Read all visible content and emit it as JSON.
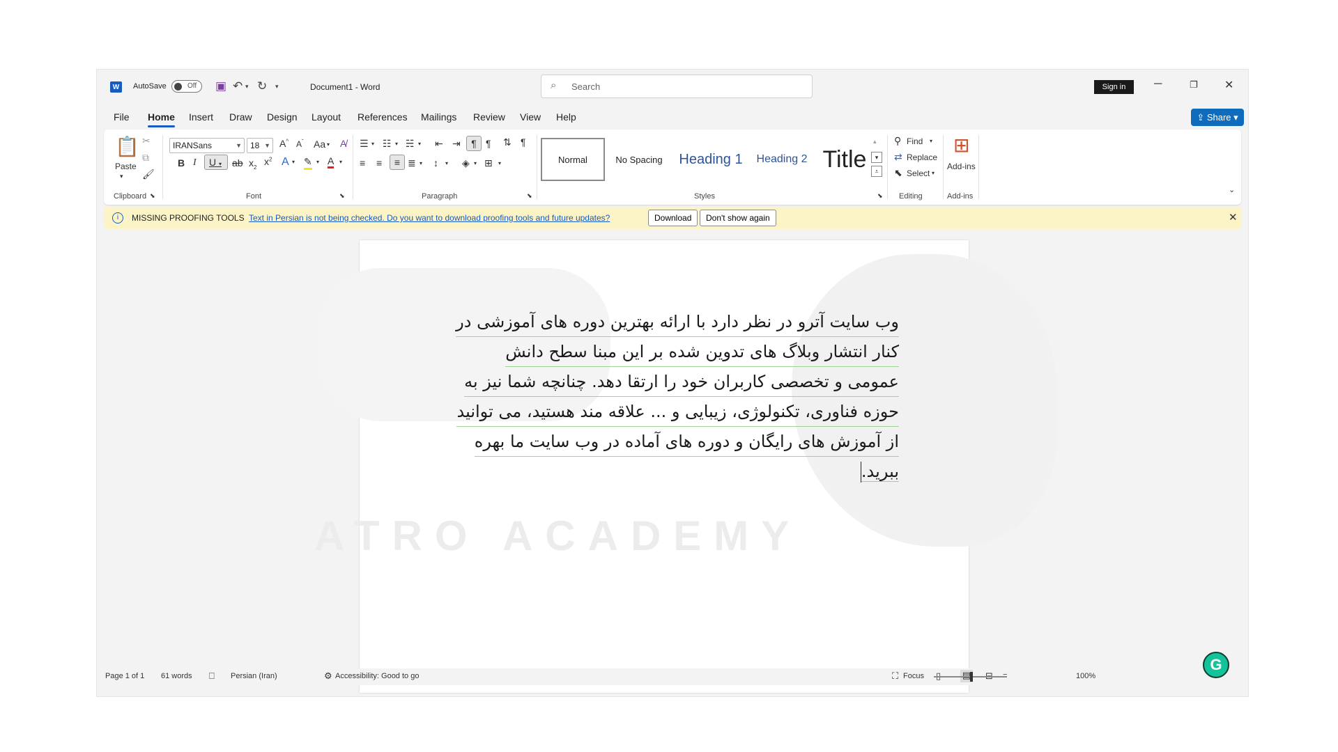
{
  "app": {
    "autosave_label": "AutoSave",
    "autosave_state": "Off",
    "document_title": "Document1 - Word",
    "search_placeholder": "Search",
    "sign_in": "Sign in",
    "share": "Share"
  },
  "menu": [
    "File",
    "Home",
    "Insert",
    "Draw",
    "Design",
    "Layout",
    "References",
    "Mailings",
    "Review",
    "View",
    "Help"
  ],
  "ribbon": {
    "clipboard": {
      "paste": "Paste",
      "label": "Clipboard"
    },
    "font": {
      "name": "IRANSans",
      "size": "18",
      "label": "Font",
      "case_label": "Aa"
    },
    "paragraph": {
      "label": "Paragraph"
    },
    "styles": {
      "items": [
        "Normal",
        "No Spacing",
        "Heading 1",
        "Heading 2",
        "Title"
      ],
      "label": "Styles"
    },
    "editing": {
      "find": "Find",
      "replace": "Replace",
      "select": "Select",
      "label": "Editing"
    },
    "addins": {
      "button": "Add-ins",
      "label": "Add-ins"
    }
  },
  "notice": {
    "title": "MISSING PROOFING TOOLS",
    "message": "Text in Persian is not being checked. Do you want to download proofing tools and future updates?",
    "download": "Download",
    "dismiss": "Don't show again"
  },
  "document": {
    "lines": [
      "وب سایت آترو در نظر دارد با ارائه بهترین دوره های آموزشی در",
      "کنار انتشار وبلاگ های تدوین شده بر این مبنا سطح  دانش",
      "عمومی و تخصصی کاربران خود را ارتقا دهد. چنانچه شما نیز به",
      "حوزه فناوری، تکنولوژی، زیبایی و ... علاقه مند هستید، می توانید",
      "از آموزش های رایگان و دوره های آماده در وب سایت ما بهره",
      "ببرید."
    ],
    "watermark": "ATRO ACADEMY"
  },
  "status": {
    "page": "Page 1 of 1",
    "words": "61 words",
    "language": "Persian (Iran)",
    "accessibility": "Accessibility: Good to go",
    "focus": "Focus",
    "zoom": "100%"
  },
  "colors": {
    "accent": "#185abd",
    "share": "#0f6cbd",
    "notice_bg": "#fcf4c6",
    "grammarly": "#15c39a"
  },
  "icons": [
    "word-logo-icon",
    "save-icon",
    "undo-icon",
    "redo-icon",
    "search-icon",
    "minimize-icon",
    "restore-icon",
    "close-icon",
    "grammarly-icon"
  ]
}
